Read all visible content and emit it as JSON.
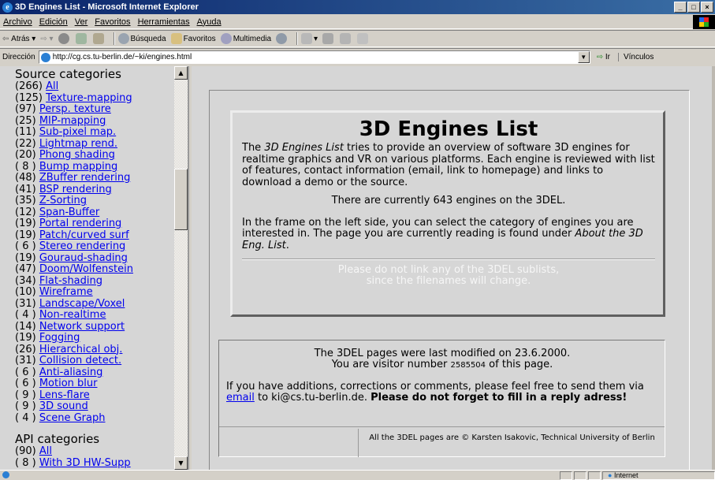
{
  "window": {
    "title": "3D Engines List - Microsoft Internet Explorer",
    "btn_min": "_",
    "btn_max": "□",
    "btn_close": "×"
  },
  "menu": [
    "Archivo",
    "Edición",
    "Ver",
    "Favoritos",
    "Herramientas",
    "Ayuda"
  ],
  "toolbar": {
    "back": "Atrás",
    "search": "Búsqueda",
    "favorites": "Favoritos",
    "multimedia": "Multimedia"
  },
  "address": {
    "label": "Dirección",
    "url": "http://cg.cs.tu-berlin.de/~ki/engines.html",
    "go": "Ir",
    "links": "Vínculos"
  },
  "sidebar": {
    "source_heading": "Source categories",
    "source_items": [
      {
        "count": "(266)",
        "label": "All"
      },
      {
        "count": "(125)",
        "label": "Texture-mapping"
      },
      {
        "count": "(97)",
        "label": "Persp. texture"
      },
      {
        "count": "(25)",
        "label": "MIP-mapping"
      },
      {
        "count": "(11)",
        "label": "Sub-pixel map."
      },
      {
        "count": "(22)",
        "label": "Lightmap rend."
      },
      {
        "count": "(20)",
        "label": "Phong shading"
      },
      {
        "count": "( 8 )",
        "label": "Bump mapping"
      },
      {
        "count": "(48)",
        "label": "ZBuffer rendering"
      },
      {
        "count": "(41)",
        "label": "BSP rendering"
      },
      {
        "count": "(35)",
        "label": "Z-Sorting"
      },
      {
        "count": "(12)",
        "label": "Span-Buffer"
      },
      {
        "count": "(19)",
        "label": "Portal rendering"
      },
      {
        "count": "(19)",
        "label": "Patch/curved surf"
      },
      {
        "count": "( 6 )",
        "label": "Stereo rendering"
      },
      {
        "count": "(19)",
        "label": "Gouraud-shading"
      },
      {
        "count": "(47)",
        "label": "Doom/Wolfenstein"
      },
      {
        "count": "(34)",
        "label": "Flat-shading"
      },
      {
        "count": "(10)",
        "label": "Wireframe"
      },
      {
        "count": "(31)",
        "label": "Landscape/Voxel"
      },
      {
        "count": "( 4 )",
        "label": "Non-realtime"
      },
      {
        "count": "(14)",
        "label": "Network support"
      },
      {
        "count": "(19)",
        "label": "Fogging"
      },
      {
        "count": "(26)",
        "label": "Hierarchical obj."
      },
      {
        "count": "(31)",
        "label": "Collision detect."
      },
      {
        "count": "( 6 )",
        "label": "Anti-aliasing"
      },
      {
        "count": "( 6 )",
        "label": "Motion blur"
      },
      {
        "count": "( 9 )",
        "label": "Lens-flare"
      },
      {
        "count": "( 9 )",
        "label": "3D sound"
      },
      {
        "count": "( 4 )",
        "label": "Scene Graph"
      }
    ],
    "api_heading": "API categories",
    "api_items": [
      {
        "count": "(90)",
        "label": "All"
      },
      {
        "count": "( 8 )",
        "label": "With 3D HW-Supp"
      }
    ]
  },
  "main": {
    "heading": "3D Engines List",
    "intro_1": "The ",
    "intro_em": "3D Engines List",
    "intro_2": " tries to provide an overview of software 3D engines for realtime graphics and VR on various platforms. Each engine is reviewed with list of features, contact information (email, link to homepage) and links to download a demo or the source.",
    "count_text": "There are currently 643 engines on the 3DEL.",
    "frame_1": "In the frame on the left side, you can select the category of engines you are interested in. The page you are currently reading is found under ",
    "frame_em": "About the 3D Eng. List",
    "frame_2": ".",
    "nolink_1": "Please do not link any of the 3DEL sublists,",
    "nolink_2": "since the filenames will change.",
    "modified": "The 3DEL pages were last modified on 23.6.2000.",
    "visitor_pre": "You are visitor number ",
    "visitor_num": "2585504",
    "visitor_post": " of this page.",
    "additions_1": "If you have additions, corrections or comments, please feel free to send them via ",
    "email_link": "email",
    "additions_2": " to ki@cs.tu-berlin.de. ",
    "reply_bold": "Please do not forget to fill in a reply adress!",
    "copyright": "All the 3DEL pages are © Karsten Isakovic, Technical University of Berlin"
  },
  "statusbar": {
    "zone": "Internet"
  }
}
